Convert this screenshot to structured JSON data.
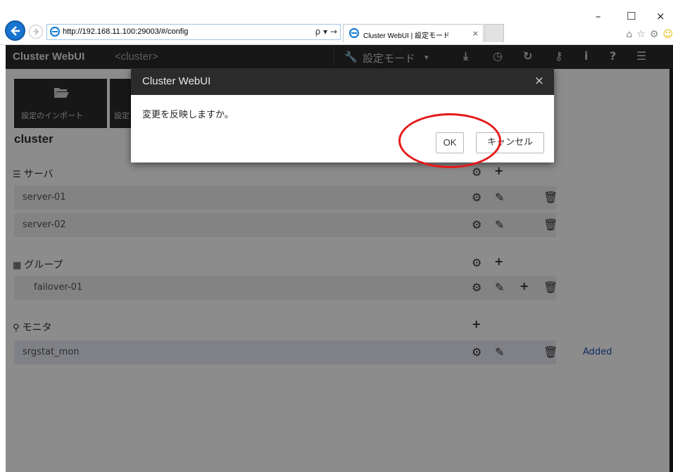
{
  "browser": {
    "url": "http://192.168.11.100:29003/#/config",
    "address_controls": "ρ ▾ →",
    "tab_title": "Cluster WebUI | 設定モード",
    "tab_close": "×",
    "window_min": "–",
    "window_max": "☐",
    "window_close": "×"
  },
  "app": {
    "title": "Cluster WebUI",
    "cluster_tag": "<cluster>",
    "mode_label": "設定モード",
    "mode_caret": "▾"
  },
  "toolbar": {
    "import_label": "設定のインポート",
    "export_label_partial": "設定"
  },
  "cluster": {
    "name": "cluster"
  },
  "sections": {
    "servers": {
      "heading": "サーバ",
      "items": [
        {
          "label": "server-01"
        },
        {
          "label": "server-02"
        }
      ]
    },
    "groups": {
      "heading": "グループ",
      "items": [
        {
          "label": "failover-01"
        }
      ]
    },
    "monitors": {
      "heading": "モニタ",
      "items": [
        {
          "label": "srgstat_mon",
          "status": "Added"
        }
      ]
    }
  },
  "dialog": {
    "title": "Cluster WebUI",
    "close_glyph": "×",
    "message": "変更を反映しますか。",
    "ok_label": "OK",
    "cancel_label": "キャンセル"
  },
  "colors": {
    "header_bg": "#2b2b2b",
    "accent_blue": "#1e4fb7",
    "highlight_ring": "#e51a1a"
  }
}
